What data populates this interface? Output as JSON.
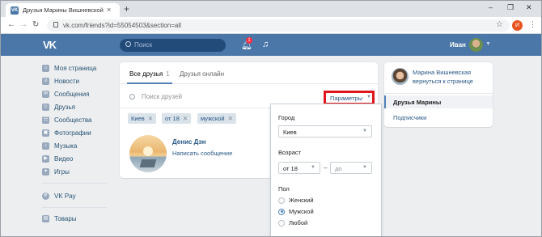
{
  "browser": {
    "tab_title": "Друзья Марины Вишневской –",
    "tab_favicon": "VK",
    "url": "vk.com/friends?id=55054503&section=all",
    "profile_initial": "И",
    "new_tab": "+",
    "close": "×"
  },
  "header": {
    "logo": "VK",
    "search_placeholder": "Поиск",
    "notification_count": "1",
    "username": "Иван"
  },
  "sidebar": {
    "items": [
      {
        "label": "Моя страница",
        "icon": "home-icon"
      },
      {
        "label": "Новости",
        "icon": "news-icon"
      },
      {
        "label": "Сообщения",
        "icon": "messages-icon"
      },
      {
        "label": "Друзья",
        "icon": "friends-icon"
      },
      {
        "label": "Сообщества",
        "icon": "communities-icon"
      },
      {
        "label": "Фотографии",
        "icon": "photos-icon"
      },
      {
        "label": "Музыка",
        "icon": "music-icon"
      },
      {
        "label": "Видео",
        "icon": "video-icon"
      },
      {
        "label": "Игры",
        "icon": "games-icon"
      },
      {
        "label": "VK Pay",
        "icon": "vkpay-icon"
      },
      {
        "label": "Товары",
        "icon": "goods-icon"
      }
    ]
  },
  "friends": {
    "tab_all": "Все друзья",
    "tab_all_count": "1",
    "tab_online": "Друзья онлайн",
    "search_placeholder": "Поиск друзей",
    "params_label": "Параметры",
    "filters": [
      "Киев",
      "от 18",
      "мужской"
    ],
    "friend_name": "Денис Дэн",
    "friend_action": "Написать сообщение"
  },
  "right_panel": {
    "owner_name": "Марина Вишневская",
    "back_link": "вернуться к странице",
    "selected_item": "Друзья Марины",
    "subscribers": "Подписчики"
  },
  "params_dropdown": {
    "city_label": "Город",
    "city_value": "Киев",
    "age_label": "Возраст",
    "age_from": "от 18",
    "age_dash": "–",
    "age_to": "до",
    "gender_label": "Пол",
    "gender_options": [
      "Женский",
      "Мужской",
      "Любой"
    ],
    "gender_selected": "Мужской"
  }
}
